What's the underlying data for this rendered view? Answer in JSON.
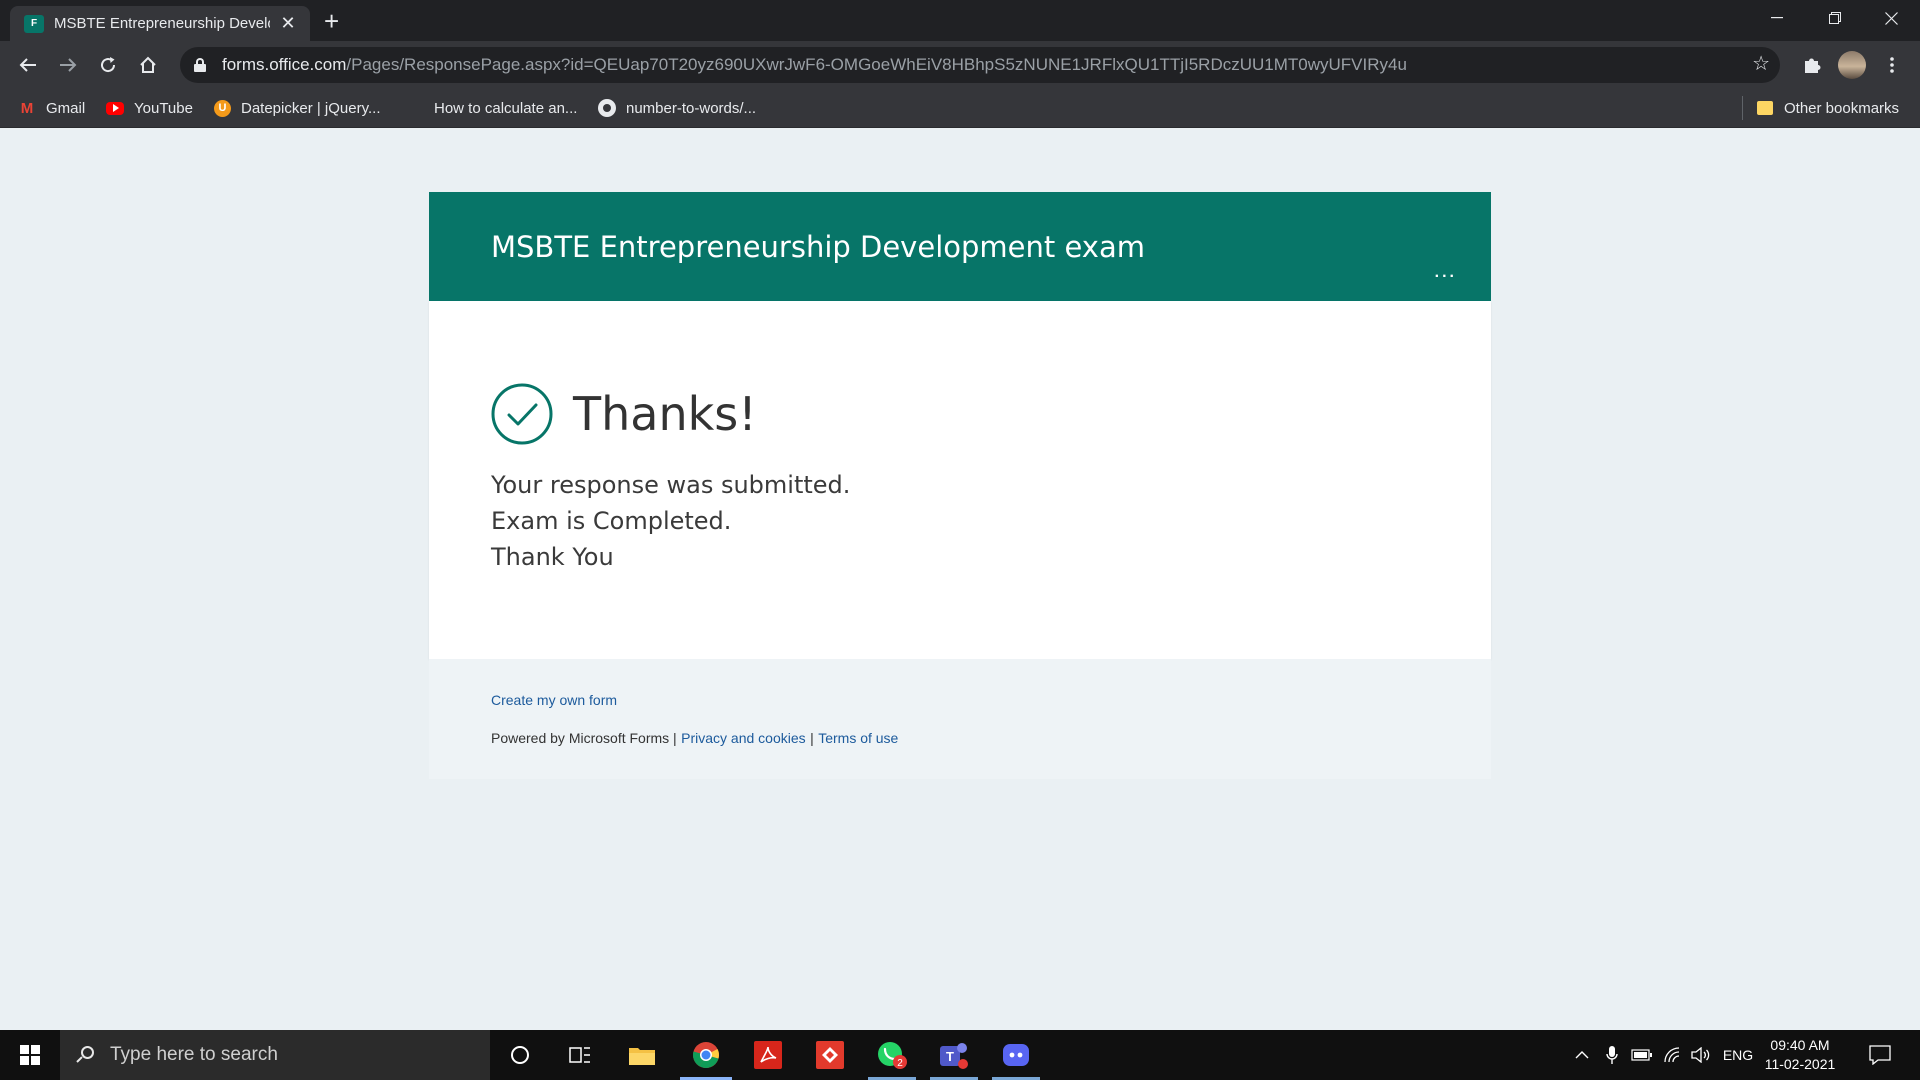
{
  "browser": {
    "tab_title": "MSBTE Entrepreneurship Develop",
    "tab_favicon_text": "F",
    "url_host": "forms.office.com",
    "url_path": "/Pages/ResponsePage.aspx?id=QEUap70T20yz690UXwrJwF6-OMGoeWhEiV8HBhpS5zNUNE1JRFlxQU1TTjI5RDczUU1MT0wyUFVIRy4u",
    "bookmarks": [
      {
        "label": "Gmail",
        "icon": "gmail-icon"
      },
      {
        "label": "YouTube",
        "icon": "youtube-icon"
      },
      {
        "label": "Datepicker | jQuery...",
        "icon": "datepicker-icon"
      },
      {
        "label": "How to calculate an...",
        "icon": "microsoft-icon"
      },
      {
        "label": "number-to-words/...",
        "icon": "github-icon"
      }
    ],
    "other_bookmarks": "Other bookmarks"
  },
  "form": {
    "title": "MSBTE Entrepreneurship Development exam",
    "more": "...",
    "thanks": "Thanks!",
    "messages": [
      "Your response was submitted.",
      "Exam is Completed.",
      "Thank You"
    ],
    "footer": {
      "create_link": "Create my own form",
      "powered_by": "Powered by Microsoft Forms |",
      "privacy_link": "Privacy and cookies",
      "separator": "|",
      "terms_link": "Terms of use"
    }
  },
  "taskbar": {
    "search_placeholder": "Type here to search",
    "language": "ENG",
    "time": "09:40 AM",
    "date": "11-02-2021",
    "whatsapp_badge": "2"
  },
  "colors": {
    "forms_teal": "#077568",
    "link_blue": "#1c5a9c",
    "page_bg": "#eaf0f3"
  }
}
